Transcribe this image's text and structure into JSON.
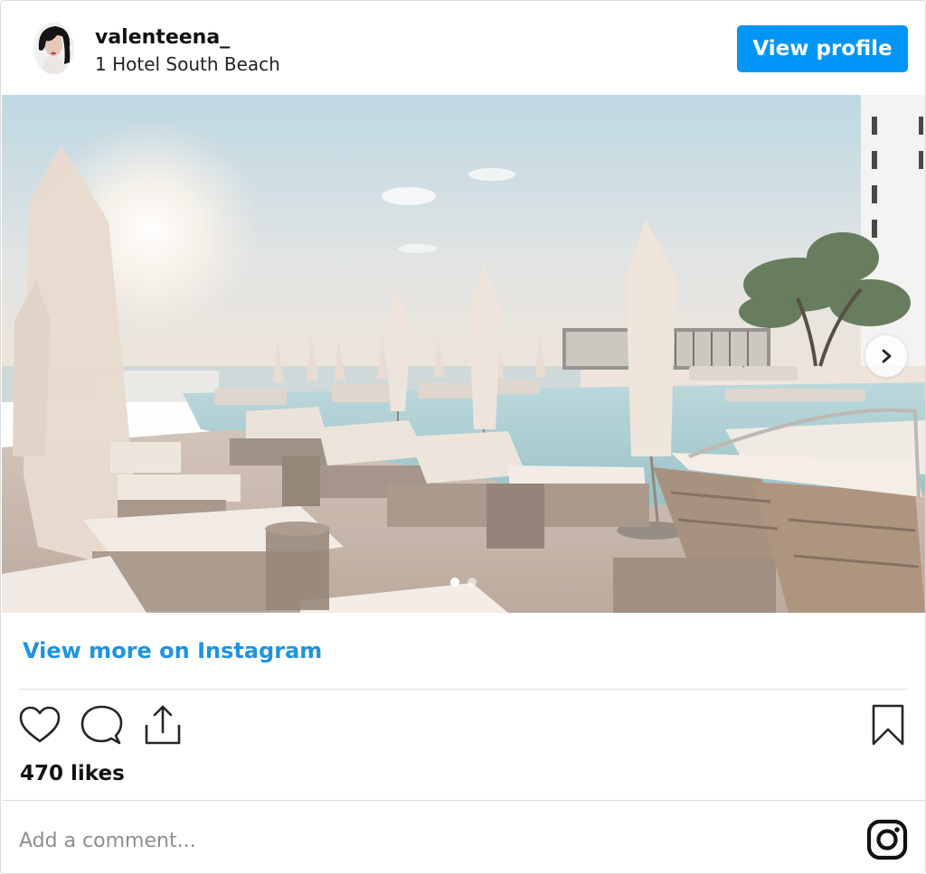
{
  "header": {
    "username": "valenteena_",
    "location": "1 Hotel South Beach",
    "view_profile_label": "View profile"
  },
  "post": {
    "image_icon": "photo-carousel",
    "carousel_dots": 2,
    "active_dot": 0,
    "view_more_label": "View more on Instagram",
    "likes_text": "470 likes"
  },
  "actions": {
    "icons": [
      "heart-icon",
      "comment-icon",
      "share-icon",
      "bookmark-icon"
    ]
  },
  "comment": {
    "placeholder": "Add a comment..."
  },
  "colors": {
    "accent": "#0095f6",
    "link": "#1f93e0",
    "divider": "#dbdbdb"
  }
}
